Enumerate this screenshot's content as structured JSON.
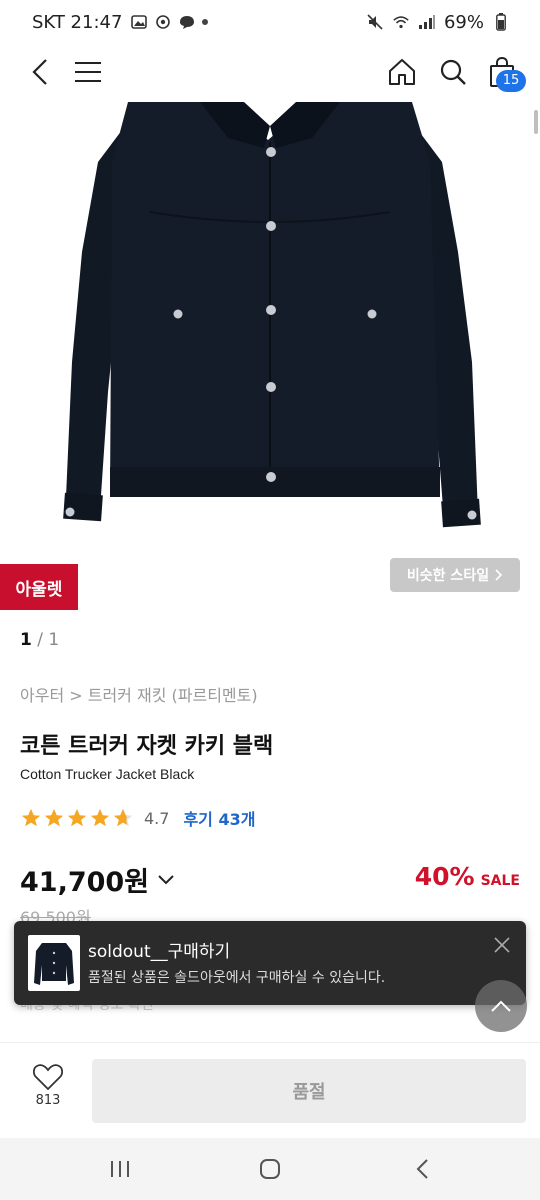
{
  "status_bar": {
    "carrier_time": "SKT 21:47",
    "battery": "69%"
  },
  "nav": {
    "cart_count": "15"
  },
  "product": {
    "outlet_badge": "아울렛",
    "similar_style": "비슷한 스타일",
    "page_current": "1",
    "page_sep_total": " / 1",
    "breadcrumb": "아우터 > 트러커 재킷 (파르티멘토)",
    "title_ko": "코튼 트러커 자켓 카키 블랙",
    "title_en": "Cotton Trucker Jacket Black",
    "rating": "4.7",
    "rating_value": 4.7,
    "review_link": "후기 43개",
    "price": "41,700원",
    "discount_pct": "40%",
    "discount_sale": "SALE",
    "original_price": "69,500원",
    "hidden_text": "배송 및 혜택 정보 확인"
  },
  "toast": {
    "title": "soldout__구매하기",
    "message": "품절된 상품은 솔드아웃에서 구매하실 수 있습니다."
  },
  "action": {
    "like_count": "813",
    "soldout_label": "품절"
  },
  "colors": {
    "accent_blue": "#1e73e8",
    "outlet_red": "#c8102e",
    "sale_red": "#d0112b",
    "star": "#f5a623"
  }
}
